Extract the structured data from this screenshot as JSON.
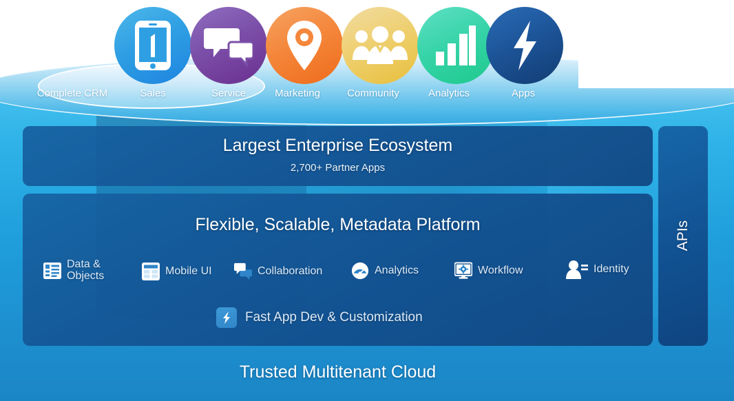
{
  "cloud": {
    "pills": [
      {
        "label": "Complete CRM",
        "icon": "none",
        "color": ""
      },
      {
        "label": "Sales",
        "icon": "phone-one-icon",
        "color": "#2f9fe3"
      },
      {
        "label": "Service",
        "icon": "chat-bubbles-icon",
        "color": "#7b4fa8"
      },
      {
        "label": "Marketing",
        "icon": "map-pin-icon",
        "color": "#f4873c"
      },
      {
        "label": "Community",
        "icon": "people-group-icon",
        "color": "#eecf6e"
      },
      {
        "label": "Analytics",
        "icon": "bar-chart-icon",
        "color": "#36d3a8"
      },
      {
        "label": "Apps",
        "icon": "lightning-bolt-icon",
        "color": "#1d5599"
      }
    ]
  },
  "ecosystem": {
    "title": "Largest Enterprise Ecosystem",
    "subtitle": "2,700+ Partner Apps"
  },
  "platform": {
    "title": "Flexible, Scalable, Metadata Platform",
    "features": [
      {
        "label": "Data &\nObjects",
        "icon": "data-objects-icon"
      },
      {
        "label": "Mobile UI",
        "icon": "mobile-ui-grid-icon"
      },
      {
        "label": "Collaboration",
        "icon": "chat-bubbles-icon"
      },
      {
        "label": "Analytics",
        "icon": "gauge-icon"
      },
      {
        "label": "Workflow",
        "icon": "monitor-gear-icon"
      },
      {
        "label": "Identity",
        "icon": "person-badge-icon"
      }
    ],
    "feature_wide": {
      "label": "Fast App Dev & Customization",
      "icon": "lightning-bolt-icon"
    }
  },
  "apis": {
    "label": "APIs"
  },
  "foundation": {
    "title": "Trusted Multitenant Cloud"
  }
}
